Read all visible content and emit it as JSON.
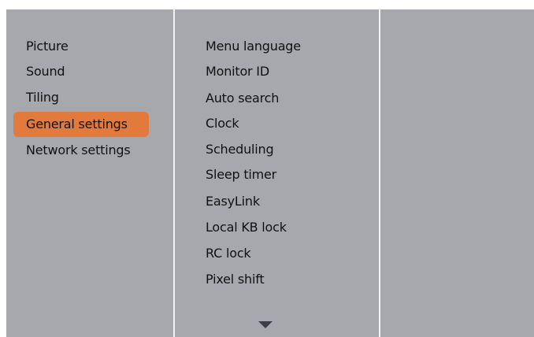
{
  "left_menu": {
    "items": [
      {
        "label": "Picture"
      },
      {
        "label": "Sound"
      },
      {
        "label": "Tiling"
      },
      {
        "label": "General settings",
        "selected": true
      },
      {
        "label": "Network settings"
      }
    ]
  },
  "sub_menu": {
    "items": [
      {
        "label": "Menu language"
      },
      {
        "label": "Monitor ID"
      },
      {
        "label": "Auto search"
      },
      {
        "label": "Clock"
      },
      {
        "label": "Scheduling"
      },
      {
        "label": "Sleep timer"
      },
      {
        "label": "EasyLink"
      },
      {
        "label": "Local KB lock"
      },
      {
        "label": "RC lock"
      },
      {
        "label": "Pixel shift"
      }
    ],
    "more_indicator": "chevron-down-icon"
  },
  "colors": {
    "panel_background": "#a7a7ae",
    "divider": "#f2f2f2",
    "selection_highlight": "#e27a3b",
    "text": "#111111"
  }
}
